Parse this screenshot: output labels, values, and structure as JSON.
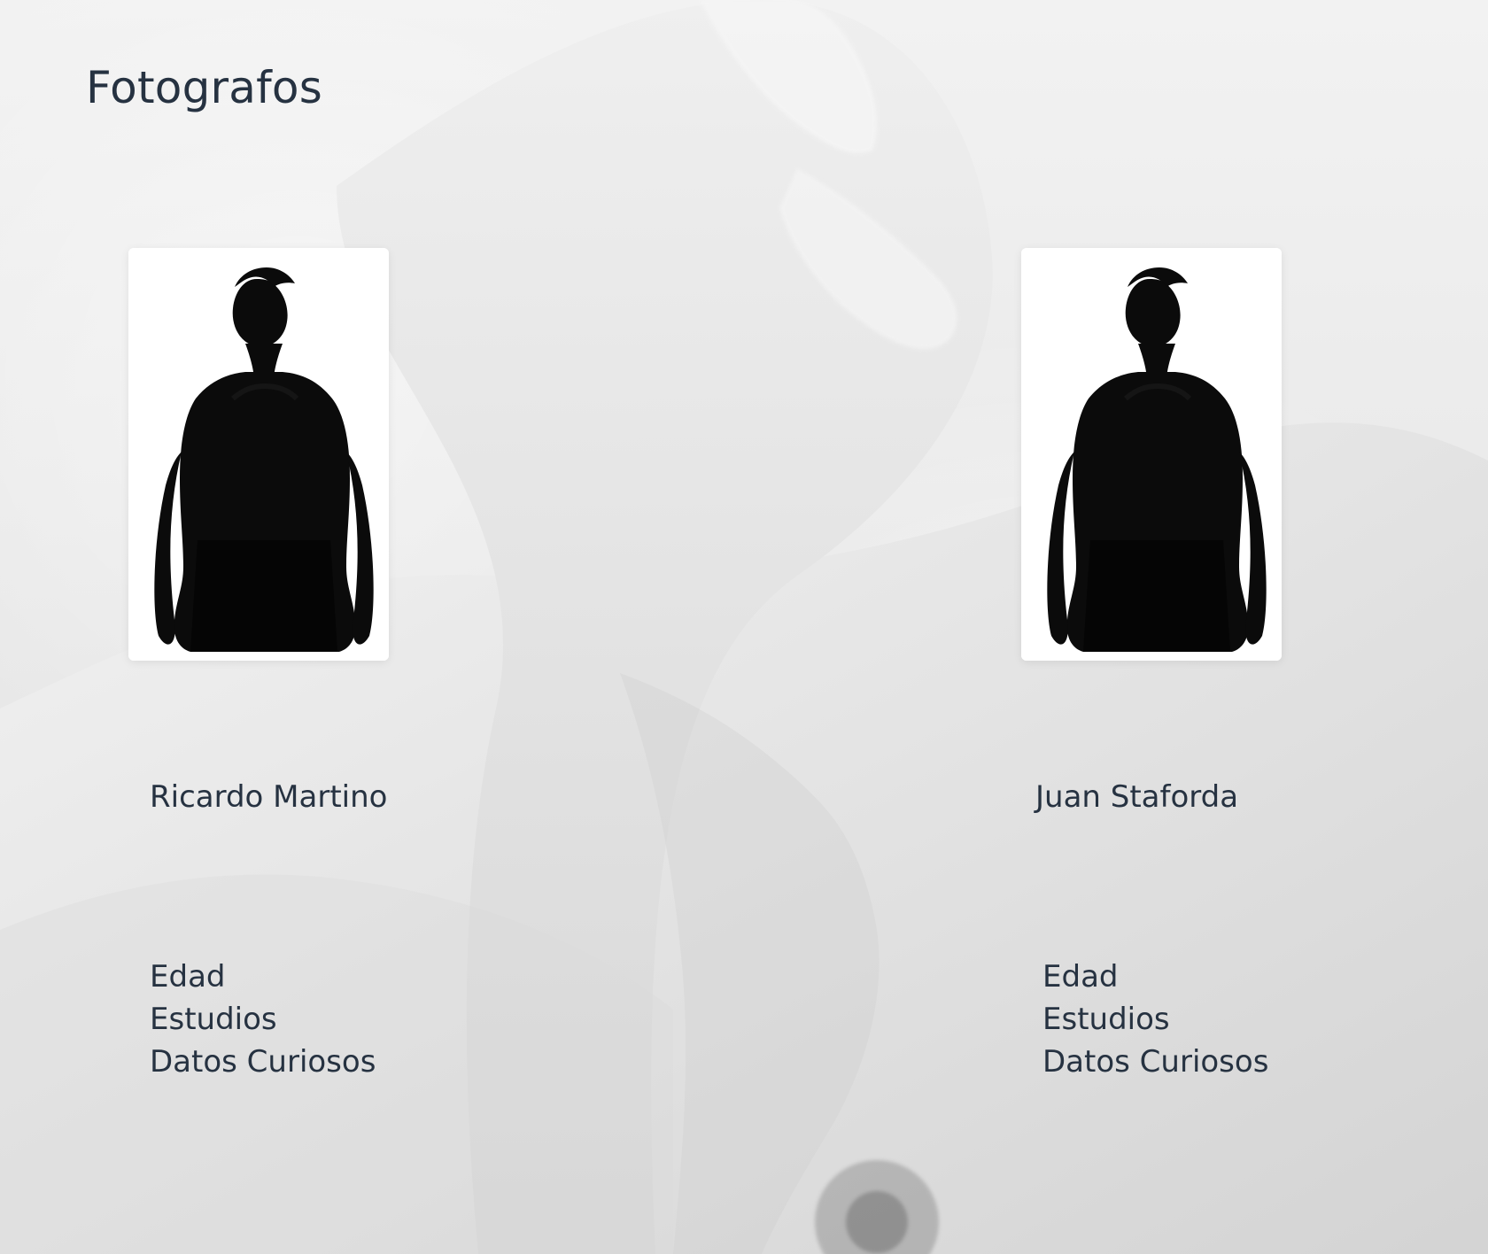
{
  "page": {
    "title": "Fotografos"
  },
  "photographers": [
    {
      "name": "Ricardo Martino",
      "details": [
        "Edad",
        "Estudios",
        "Datos Curiosos"
      ]
    },
    {
      "name": "Juan Staforda",
      "details": [
        "Edad",
        "Estudios",
        "Datos Curiosos"
      ]
    }
  ],
  "colors": {
    "text": "#263241",
    "background": "#e9e9e9",
    "card": "#ffffff"
  },
  "icons": {
    "portrait": "silhouette-portrait"
  }
}
